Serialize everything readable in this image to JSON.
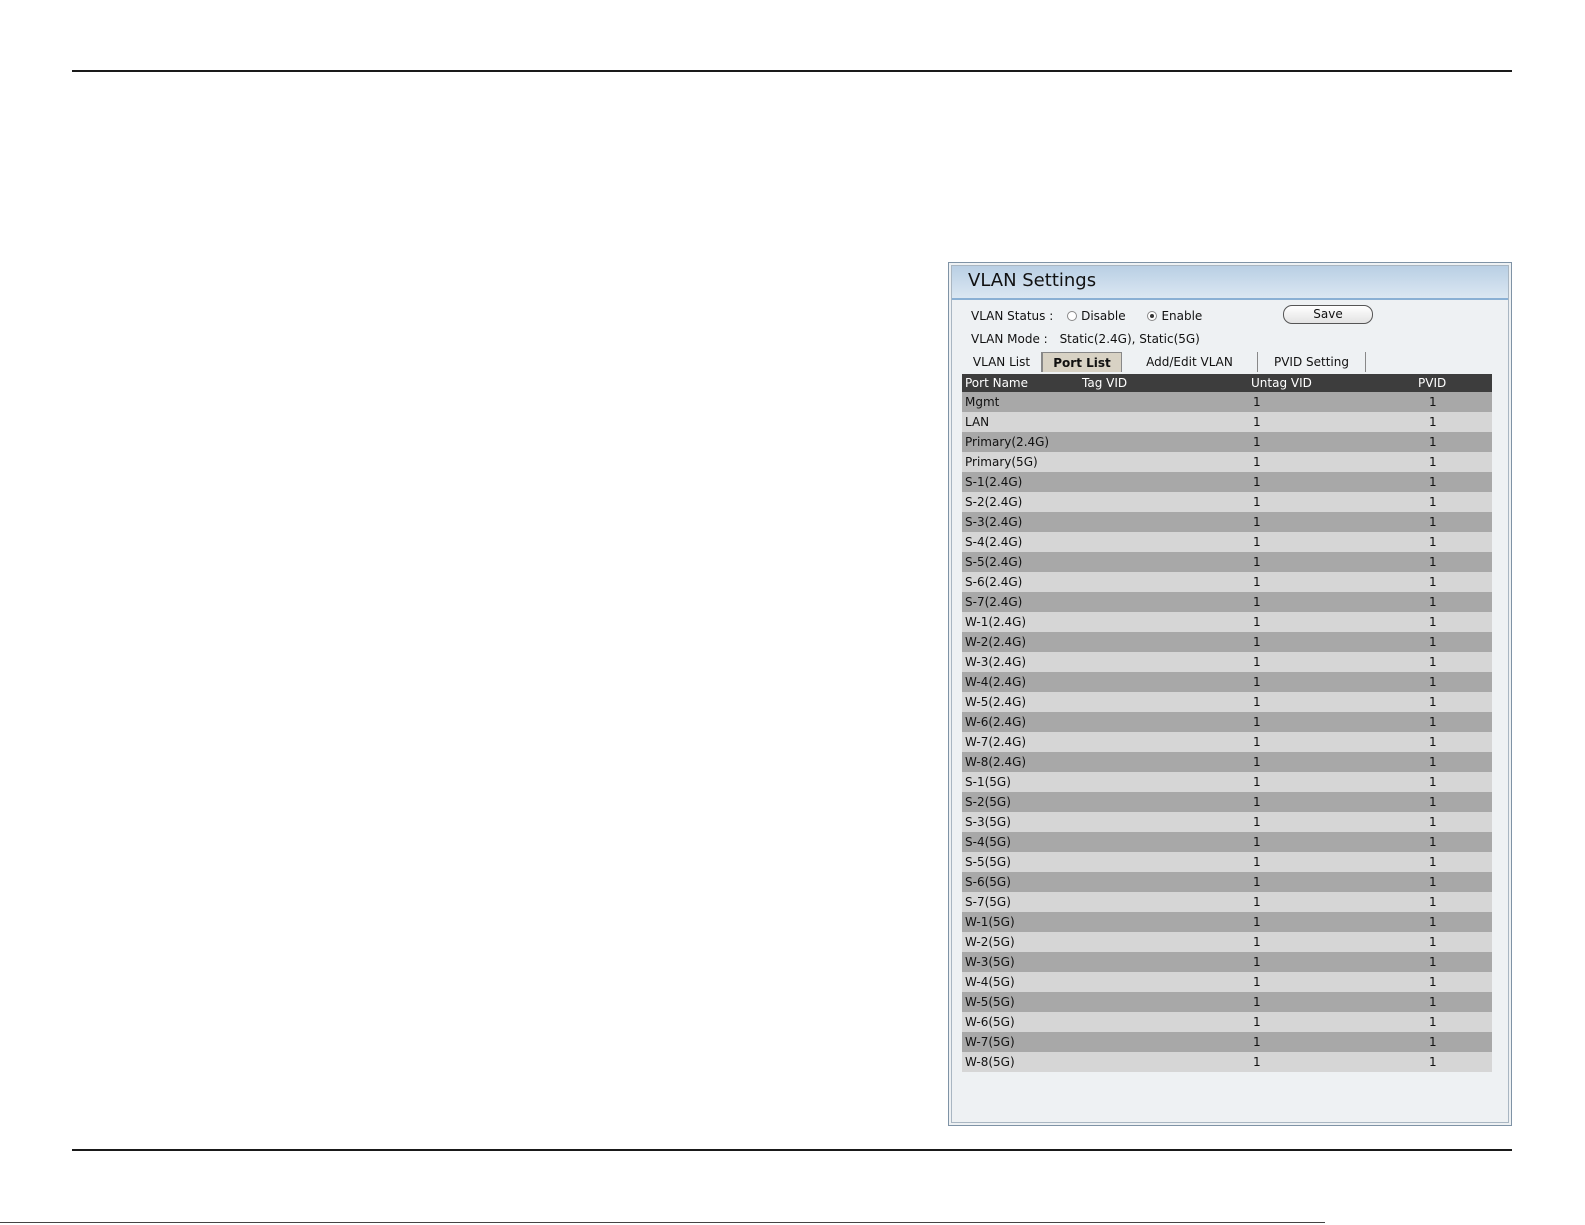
{
  "panel": {
    "title": "VLAN Settings",
    "status_label": "VLAN Status  :",
    "disable_label": "Disable",
    "enable_label": "Enable",
    "selected": "Enable",
    "save_label": "Save",
    "mode_label": "VLAN Mode  :",
    "mode_value": "Static(2.4G),  Static(5G)"
  },
  "tabs": [
    {
      "label": "VLAN List",
      "active": false
    },
    {
      "label": "Port List",
      "active": true
    },
    {
      "label": "Add/Edit VLAN",
      "active": false
    },
    {
      "label": "PVID Setting",
      "active": false
    }
  ],
  "table": {
    "headers": [
      "Port Name",
      "Tag VID",
      "Untag VID",
      "PVID"
    ],
    "rows": [
      {
        "name": "Mgmt",
        "tag": "",
        "untag": "1",
        "pvid": "1"
      },
      {
        "name": "LAN",
        "tag": "",
        "untag": "1",
        "pvid": "1"
      },
      {
        "name": "Primary(2.4G)",
        "tag": "",
        "untag": "1",
        "pvid": "1"
      },
      {
        "name": "Primary(5G)",
        "tag": "",
        "untag": "1",
        "pvid": "1"
      },
      {
        "name": "S-1(2.4G)",
        "tag": "",
        "untag": "1",
        "pvid": "1"
      },
      {
        "name": "S-2(2.4G)",
        "tag": "",
        "untag": "1",
        "pvid": "1"
      },
      {
        "name": "S-3(2.4G)",
        "tag": "",
        "untag": "1",
        "pvid": "1"
      },
      {
        "name": "S-4(2.4G)",
        "tag": "",
        "untag": "1",
        "pvid": "1"
      },
      {
        "name": "S-5(2.4G)",
        "tag": "",
        "untag": "1",
        "pvid": "1"
      },
      {
        "name": "S-6(2.4G)",
        "tag": "",
        "untag": "1",
        "pvid": "1"
      },
      {
        "name": "S-7(2.4G)",
        "tag": "",
        "untag": "1",
        "pvid": "1"
      },
      {
        "name": "W-1(2.4G)",
        "tag": "",
        "untag": "1",
        "pvid": "1"
      },
      {
        "name": "W-2(2.4G)",
        "tag": "",
        "untag": "1",
        "pvid": "1"
      },
      {
        "name": "W-3(2.4G)",
        "tag": "",
        "untag": "1",
        "pvid": "1"
      },
      {
        "name": "W-4(2.4G)",
        "tag": "",
        "untag": "1",
        "pvid": "1"
      },
      {
        "name": "W-5(2.4G)",
        "tag": "",
        "untag": "1",
        "pvid": "1"
      },
      {
        "name": "W-6(2.4G)",
        "tag": "",
        "untag": "1",
        "pvid": "1"
      },
      {
        "name": "W-7(2.4G)",
        "tag": "",
        "untag": "1",
        "pvid": "1"
      },
      {
        "name": "W-8(2.4G)",
        "tag": "",
        "untag": "1",
        "pvid": "1"
      },
      {
        "name": "S-1(5G)",
        "tag": "",
        "untag": "1",
        "pvid": "1"
      },
      {
        "name": "S-2(5G)",
        "tag": "",
        "untag": "1",
        "pvid": "1"
      },
      {
        "name": "S-3(5G)",
        "tag": "",
        "untag": "1",
        "pvid": "1"
      },
      {
        "name": "S-4(5G)",
        "tag": "",
        "untag": "1",
        "pvid": "1"
      },
      {
        "name": "S-5(5G)",
        "tag": "",
        "untag": "1",
        "pvid": "1"
      },
      {
        "name": "S-6(5G)",
        "tag": "",
        "untag": "1",
        "pvid": "1"
      },
      {
        "name": "S-7(5G)",
        "tag": "",
        "untag": "1",
        "pvid": "1"
      },
      {
        "name": "W-1(5G)",
        "tag": "",
        "untag": "1",
        "pvid": "1"
      },
      {
        "name": "W-2(5G)",
        "tag": "",
        "untag": "1",
        "pvid": "1"
      },
      {
        "name": "W-3(5G)",
        "tag": "",
        "untag": "1",
        "pvid": "1"
      },
      {
        "name": "W-4(5G)",
        "tag": "",
        "untag": "1",
        "pvid": "1"
      },
      {
        "name": "W-5(5G)",
        "tag": "",
        "untag": "1",
        "pvid": "1"
      },
      {
        "name": "W-6(5G)",
        "tag": "",
        "untag": "1",
        "pvid": "1"
      },
      {
        "name": "W-7(5G)",
        "tag": "",
        "untag": "1",
        "pvid": "1"
      },
      {
        "name": "W-8(5G)",
        "tag": "",
        "untag": "1",
        "pvid": "1"
      }
    ]
  },
  "colors": {
    "header_bg": "#b9cfe4",
    "grid_head_bg": "#3d3d3d",
    "row_dark": "#a8a8a8",
    "row_light": "#d6d6d6",
    "active_tab": "#d8d2c4"
  }
}
